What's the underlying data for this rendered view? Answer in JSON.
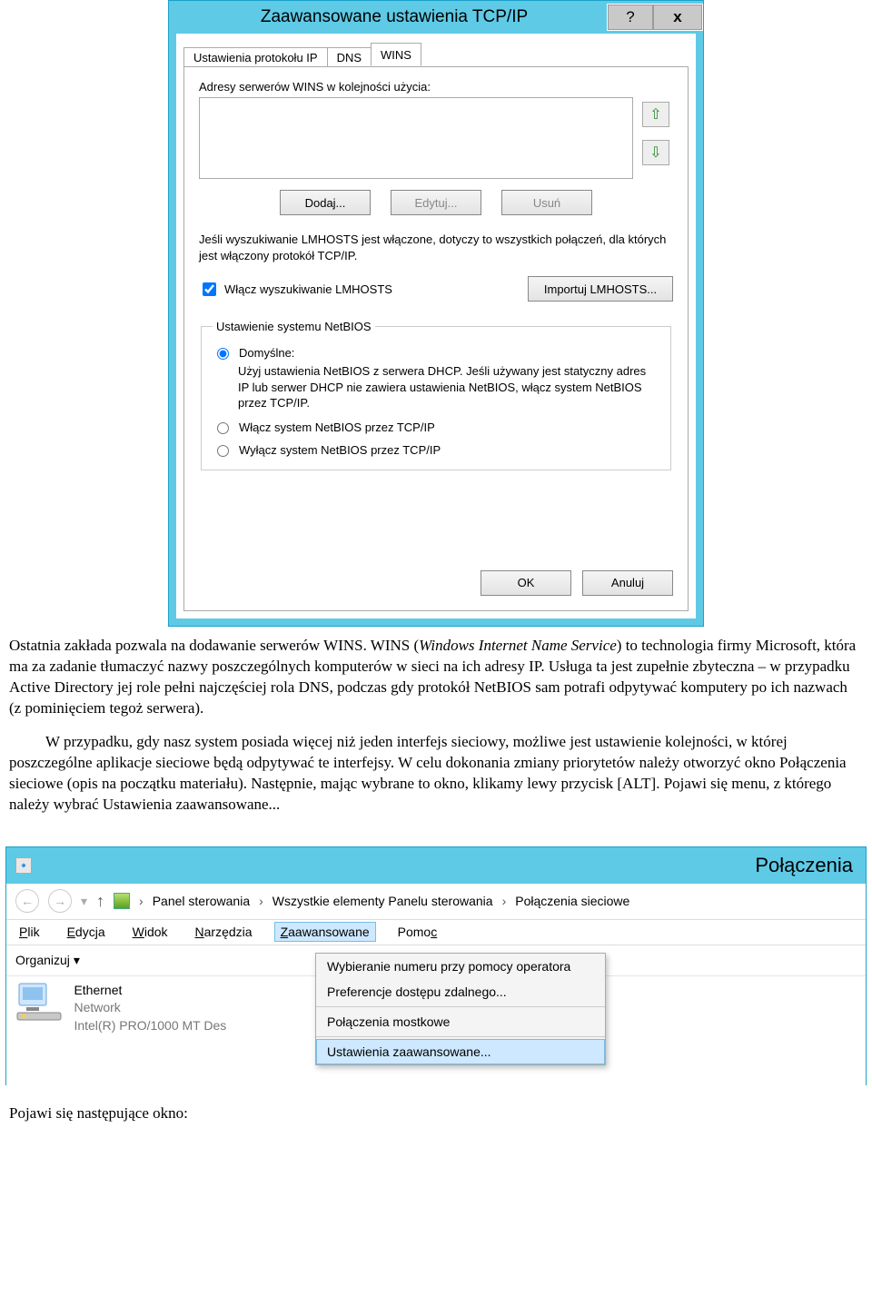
{
  "dialog1": {
    "title": "Zaawansowane ustawienia TCP/IP",
    "help_glyph": "?",
    "close_glyph": "x",
    "tabs": {
      "ip": "Ustawienia protokołu IP",
      "dns": "DNS",
      "wins": "WINS"
    },
    "wins_label": "Adresy serwerów WINS w kolejności użycia:",
    "btn_add": "Dodaj...",
    "btn_edit": "Edytuj...",
    "btn_remove": "Usuń",
    "lmhosts_info": "Jeśli wyszukiwanie LMHOSTS jest włączone, dotyczy to wszystkich połączeń, dla których jest włączony protokół TCP/IP.",
    "chk_lmhosts": "Włącz wyszukiwanie LMHOSTS",
    "btn_import": "Importuj LMHOSTS...",
    "netbios_legend": "Ustawienie systemu NetBIOS",
    "radio_default_label": "Domyślne:",
    "radio_default_desc": "Użyj ustawienia NetBIOS z serwera DHCP. Jeśli używany jest statyczny adres IP lub serwer DHCP nie zawiera ustawienia NetBIOS, włącz system NetBIOS przez TCP/IP.",
    "radio_enable": "Włącz system NetBIOS przez TCP/IP",
    "radio_disable": "Wyłącz system NetBIOS przez TCP/IP",
    "btn_ok": "OK",
    "btn_cancel": "Anuluj"
  },
  "article": {
    "p1a": "Ostatnia zakłada pozwala na dodawanie serwerów WINS. WINS (",
    "p1b": "Windows Internet Name Service",
    "p1c": ") to technologia firmy Microsoft, która ma za zadanie tłumaczyć nazwy poszczególnych komputerów w sieci na ich adresy IP. Usługa ta jest zupełnie zbyteczna – w przypadku Active Directory jej role pełni najczęściej rola DNS, podczas gdy protokół NetBIOS sam potrafi odpytywać komputery po ich nazwach (z pominięciem tegoż serwera).",
    "p2": "W przypadku, gdy nasz system posiada więcej niż jeden interfejs sieciowy, możliwe jest ustawienie kolejności, w której poszczególne aplikacje sieciowe będą odpytywać te interfejsy. W celu dokonania zmiany priorytetów należy otworzyć okno Połączenia sieciowe (opis na początku materiału). Następnie, mając wybrane to okno, klikamy lewy przycisk [ALT]. Pojawi się menu, z którego należy wybrać Ustawienia zaawansowane...",
    "p3": "Pojawi się następujące okno:"
  },
  "win2": {
    "title": "Połączenia",
    "crumbs": {
      "c1": "Panel sterowania",
      "c2": "Wszystkie elementy Panelu sterowania",
      "c3": "Połączenia sieciowe"
    },
    "menus": {
      "file": "Plik",
      "edit": "Edycja",
      "view": "Widok",
      "tools": "Narzędzia",
      "advanced": "Zaawansowane",
      "help": "Pomoc"
    },
    "toolbar": {
      "organize": "Organizuj"
    },
    "dropdown": {
      "d1": "Wybieranie numeru przy pomocy operatora",
      "d2": "Preferencje dostępu zdalnego...",
      "d3": "Połączenia mostkowe",
      "d4": "Ustawienia zaawansowane..."
    },
    "adapter": {
      "name": "Ethernet",
      "network": "Network",
      "device": "Intel(R) PRO/1000 MT Des"
    }
  }
}
